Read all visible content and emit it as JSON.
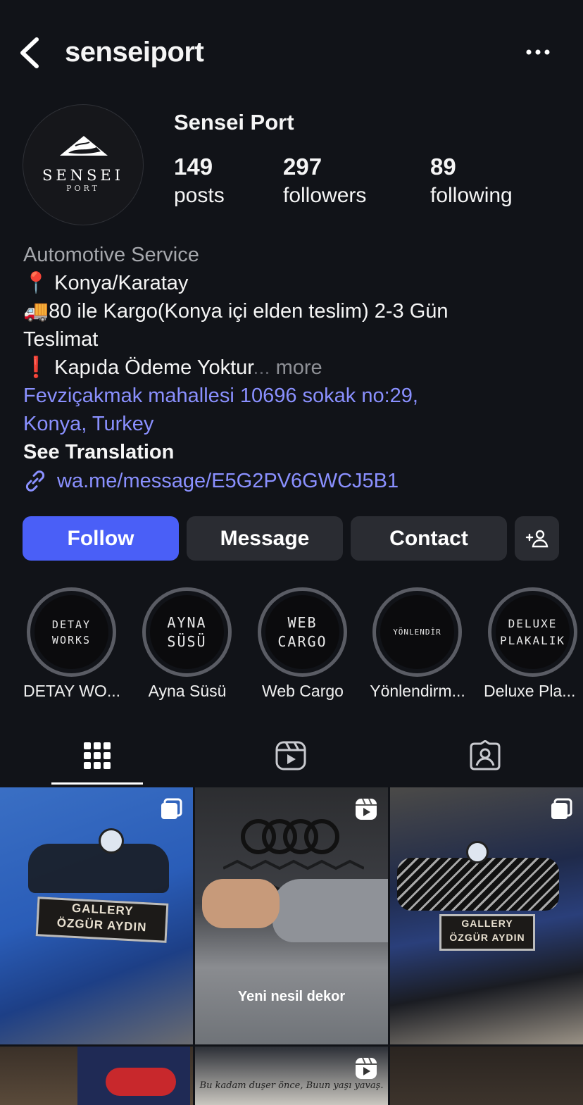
{
  "header": {
    "username": "senseiport",
    "back_icon": "chevron-left-icon",
    "more_icon": "ellipsis-icon"
  },
  "profile": {
    "avatar_brand": "SENSEI",
    "avatar_brand_sub": "PORT",
    "full_name": "Sensei Port",
    "stats": [
      {
        "value": "149",
        "label": "posts"
      },
      {
        "value": "297",
        "label": "followers"
      },
      {
        "value": "89",
        "label": "following"
      }
    ]
  },
  "bio": {
    "category": "Automotive Service",
    "line1": "📍 Konya/Karatay",
    "line2": "🚚80 ile Kargo(Konya içi elden teslim) 2-3 Gün",
    "line3": "Teslimat",
    "line4": "❗ Kapıda Ödeme Yoktur",
    "ellipsis": "...",
    "more": "more",
    "address_line1": "Fevziçakmak mahallesi 10696 sokak no:29,",
    "address_line2": "Konya, Turkey",
    "see_translation": "See Translation",
    "link": "wa.me/message/E5G2PV6GWCJ5B1"
  },
  "actions": {
    "follow": "Follow",
    "message": "Message",
    "contact": "Contact",
    "add_person_icon": "add-person-icon",
    "accent_color": "#4a5ff7"
  },
  "highlights": [
    {
      "cover": "DETAY\nWORKS",
      "label": "DETAY WO..."
    },
    {
      "cover": "AYNA\nSÜSÜ",
      "label": "Ayna Süsü"
    },
    {
      "cover": "WEB\nCARGO",
      "label": "Web Cargo"
    },
    {
      "cover": "YÖNLENDİR",
      "label": "Yönlendirm..."
    },
    {
      "cover": "DELUXE\nPLAKALIK",
      "label": "Deluxe Pla..."
    }
  ],
  "tabs": [
    {
      "icon": "grid-icon",
      "selected": true
    },
    {
      "icon": "reels-icon",
      "selected": false
    },
    {
      "icon": "tagged-icon",
      "selected": false
    }
  ],
  "grid": {
    "tile1": {
      "plate_line1": "GALLERY",
      "plate_line2": "ÖZGÜR AYDIN",
      "badge": "carousel-icon"
    },
    "tile2": {
      "caption": "Yeni nesil dekor",
      "badge": "reels-icon"
    },
    "tile3": {
      "plate_line1": "GALLERY",
      "plate_line2": "ÖZGÜR AYDIN",
      "badge": "carousel-icon"
    },
    "tile5": {
      "caption": "Bu kadam duşer önce, Buun yaşı yavaş.",
      "badge": "reels-icon"
    }
  }
}
